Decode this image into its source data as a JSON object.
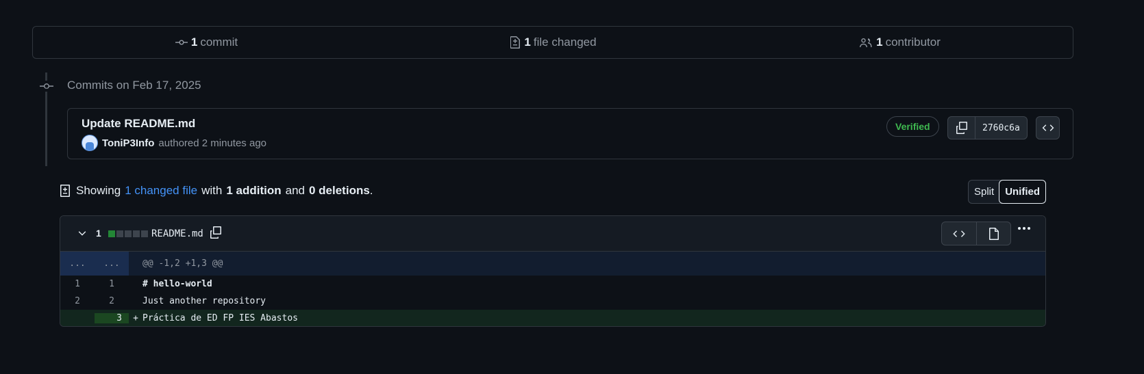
{
  "summary": {
    "commits_count": "1",
    "commits_label": "commit",
    "files_count": "1",
    "files_label": "file changed",
    "contributors_count": "1",
    "contributors_label": "contributor"
  },
  "timeline": {
    "heading": "Commits on Feb 17, 2025"
  },
  "commit": {
    "title": "Update README.md",
    "author": "ToniP3Info",
    "authored_text": "authored 2 minutes ago",
    "verified_label": "Verified",
    "sha": "2760c6a"
  },
  "diff_summary": {
    "prefix": "Showing",
    "changed_files_link": "1 changed file",
    "with": "with",
    "additions": "1 addition",
    "and": "and",
    "deletions": "0 deletions",
    "suffix": "."
  },
  "view_toggle": {
    "split_label": "Split",
    "unified_label": "Unified",
    "active": "Unified"
  },
  "file": {
    "change_count": "1",
    "name": "README.md",
    "diffstat": {
      "additions": 1,
      "deletions": 0
    },
    "hunk": {
      "old_ln": "...",
      "new_ln": "...",
      "header": "@@ -1,2 +1,3 @@"
    },
    "lines": [
      {
        "old": "1",
        "new": "1",
        "sign": " ",
        "text": "# hello-world",
        "type": "context"
      },
      {
        "old": "2",
        "new": "2",
        "sign": " ",
        "text": "Just another repository",
        "type": "context"
      },
      {
        "old": "",
        "new": "3",
        "sign": "+",
        "text": "Práctica de ED FP IES Abastos",
        "type": "addition"
      }
    ]
  },
  "colors": {
    "background": "#0d1117",
    "border": "#30363d",
    "link": "#4493f8",
    "verified": "#3fb950",
    "addition_bg": "#12261e",
    "hunk_bg": "#121d2f"
  }
}
